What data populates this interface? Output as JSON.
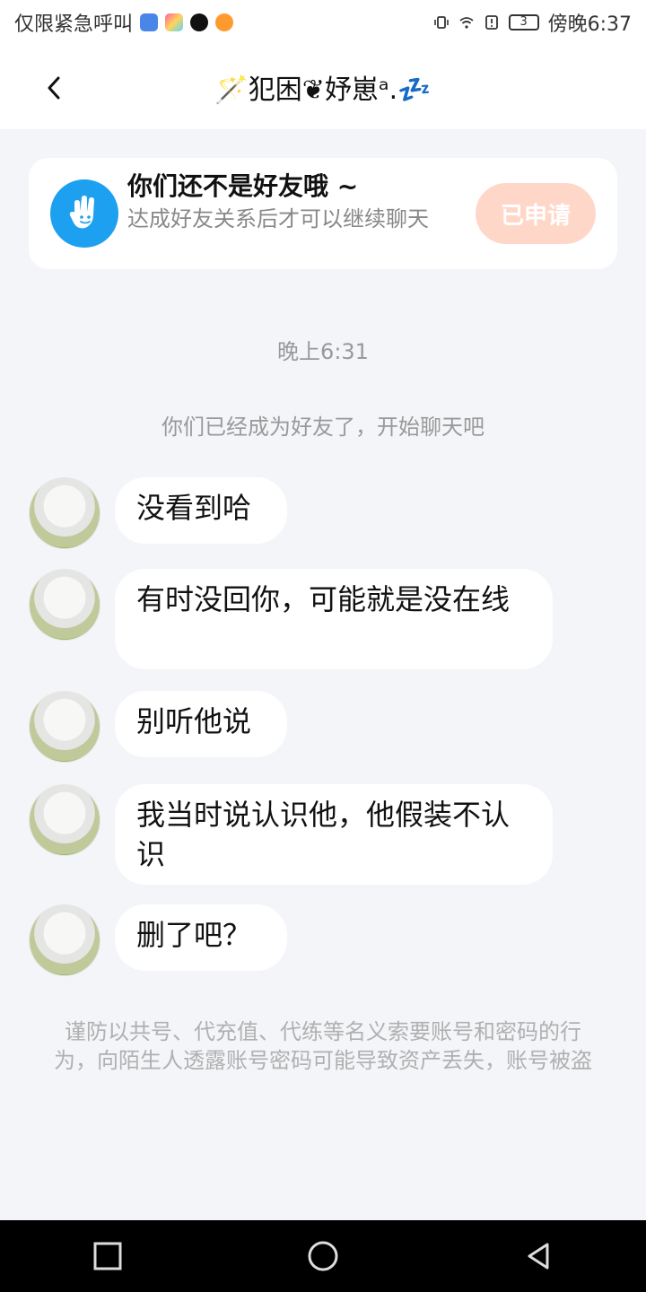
{
  "status_bar": {
    "left_text": "仅限紧急呼叫",
    "app_icons": [
      "shield-app-icon",
      "gradient-app-icon",
      "tiktok-icon",
      "orange-app-icon"
    ],
    "battery_level": "3",
    "time": "傍晚6:37"
  },
  "header": {
    "back_label": "返回",
    "title": "🪄犯困❦妤崽ᵃ.💤"
  },
  "friend_notice": {
    "title": "你们还不是好友哦 ~",
    "description": "达成好友关系后才可以继续聊天",
    "button": "已申请",
    "accent_color": "#1ea0f0",
    "button_color": "#ffd7c9"
  },
  "chat": {
    "timestamp": "晚上6:31",
    "system_message": "你们已经成为好友了，开始聊天吧",
    "messages": [
      {
        "text": "没看到哈"
      },
      {
        "text": "有时没回你，可能就是没在线"
      },
      {
        "text": "别听他说"
      },
      {
        "text": "我当时说认识他，他假装不认识"
      },
      {
        "text": "删了吧？"
      }
    ]
  },
  "footer_note": "谨防以共号、代充值、代练等名义索要账号和密码的行为，向陌生人透露账号密码可能导致资产丢失，账号被盗"
}
